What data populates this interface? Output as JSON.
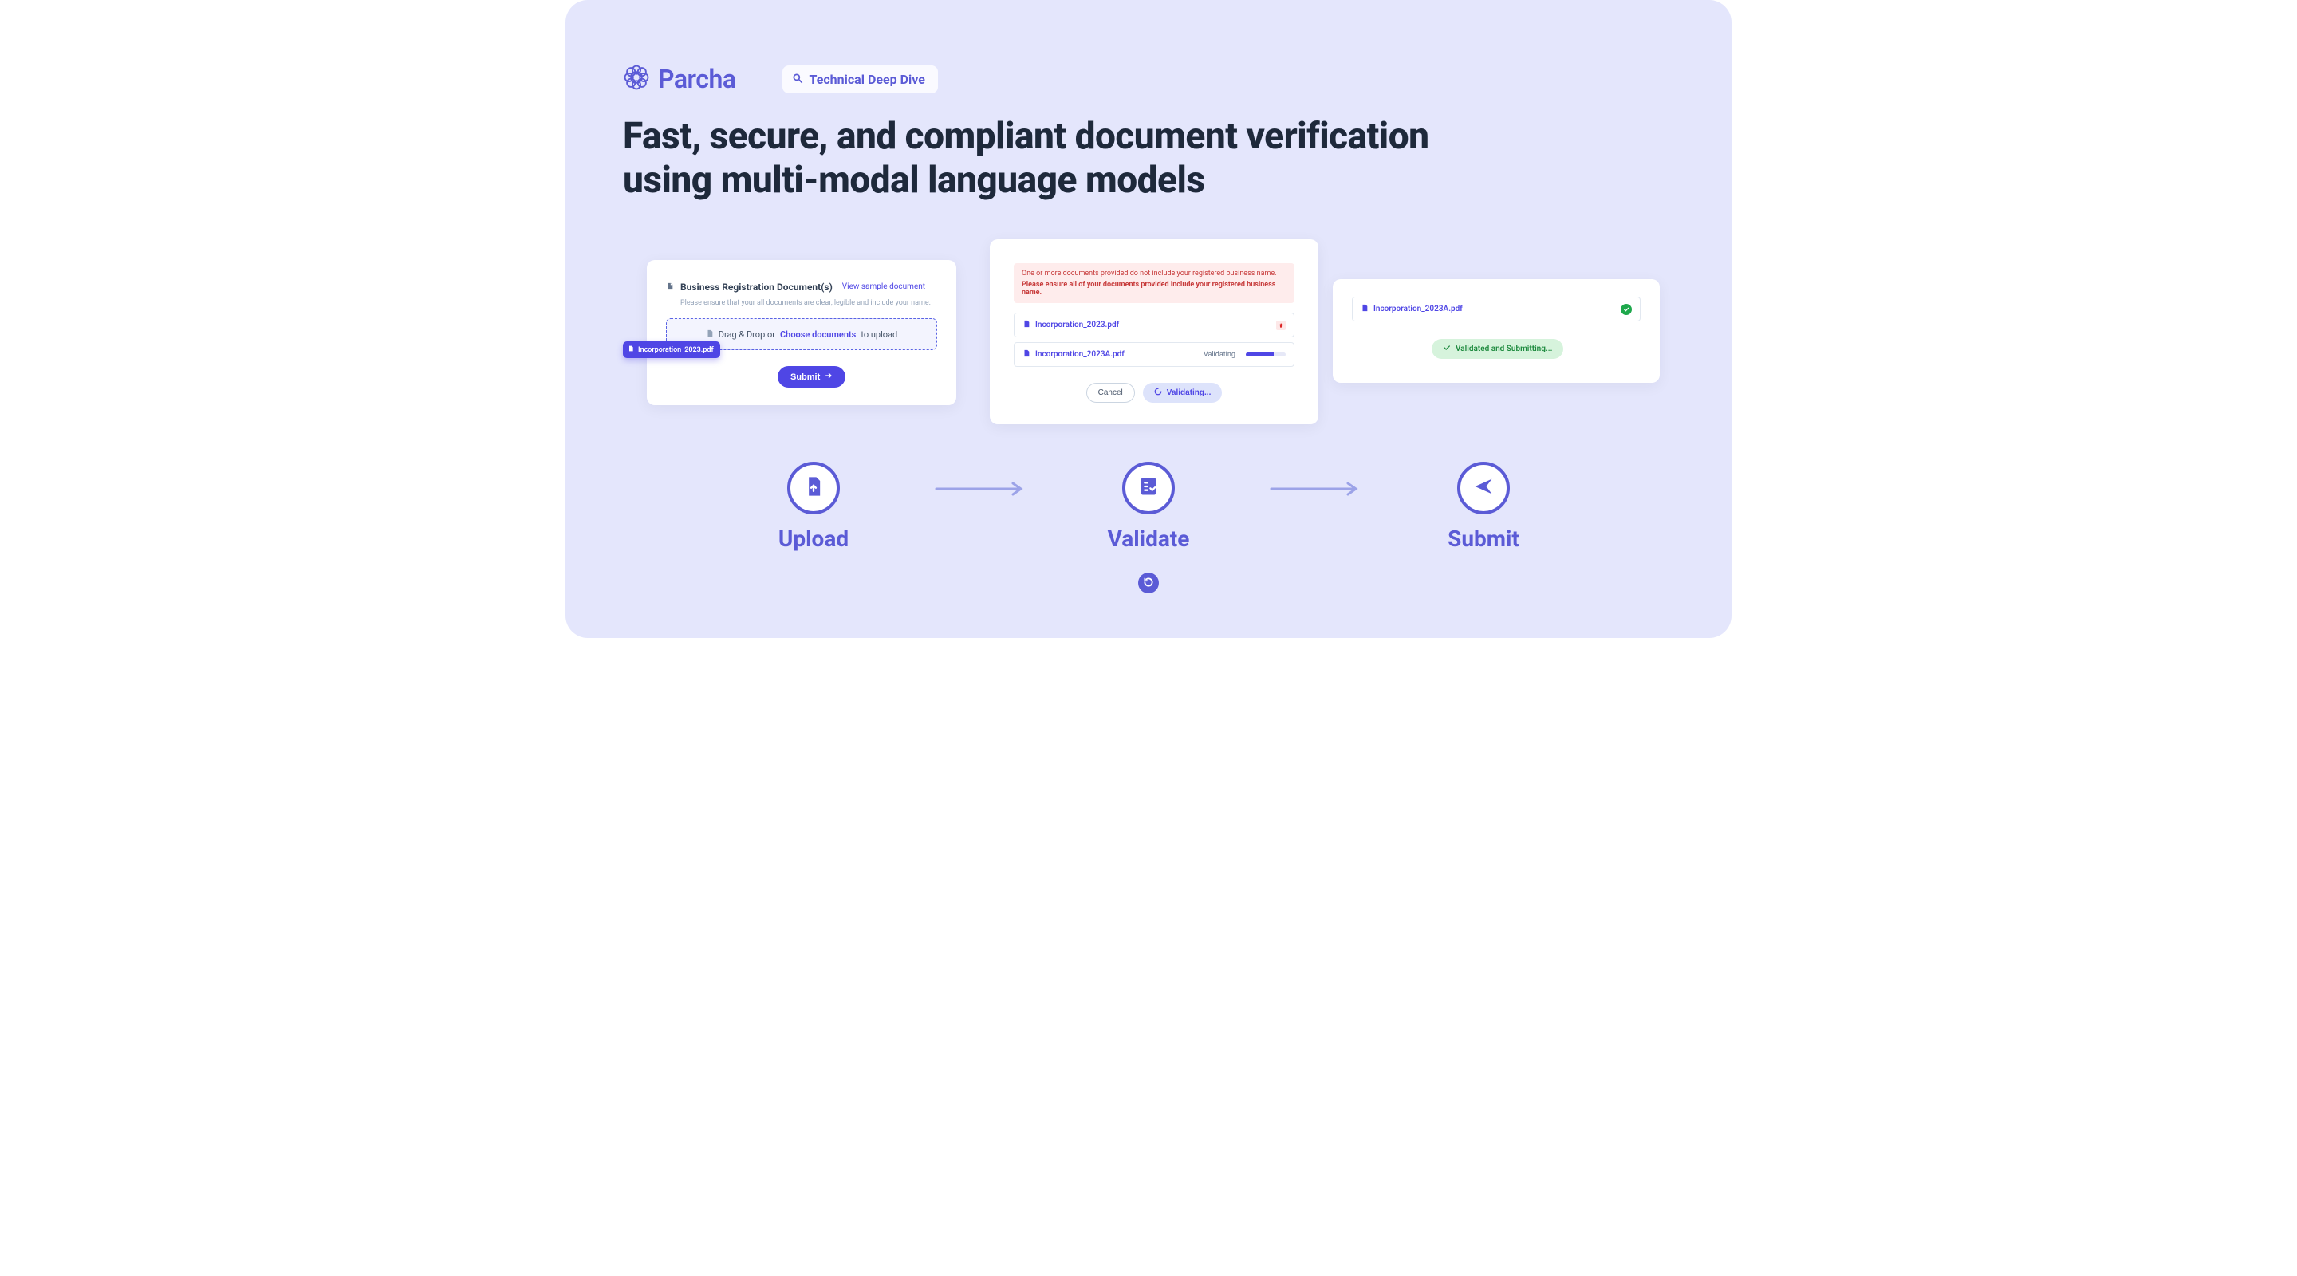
{
  "brand": {
    "name": "Parcha"
  },
  "badge": {
    "label": "Technical Deep Dive"
  },
  "headline": "Fast, secure, and compliant document verification using multi-modal language models",
  "card_upload": {
    "title": "Business Registration Document(s)",
    "sample_link": "View sample document",
    "subtitle": "Please ensure that your all documents are clear, legible and include your name.",
    "drop_prefix": "Drag & Drop or ",
    "drop_action": "Choose documents",
    "drop_suffix": " to upload",
    "dragged_file": "Incorporation_2023.pdf",
    "submit": "Submit"
  },
  "card_validate": {
    "alert_line1": "One or more documents provided do not include your registered business name.",
    "alert_line2": "Please ensure all of your documents provided include your registered business name.",
    "file_error": "Incorporation_2023.pdf",
    "file_progress": "Incorporation_2023A.pdf",
    "progress_label": "Validating...",
    "cancel": "Cancel",
    "validating": "Validating..."
  },
  "card_submit": {
    "file": "Incorporation_2023A.pdf",
    "status": "Validated and Submitting..."
  },
  "steps": {
    "upload": "Upload",
    "validate": "Validate",
    "submit": "Submit"
  },
  "colors": {
    "bg": "#E4E6FC",
    "indigo": "#5B5BD6",
    "indigoStrong": "#4F46E5",
    "text": "#1E293B",
    "danger": "#C73A3A",
    "success": "#1D8A3E"
  }
}
